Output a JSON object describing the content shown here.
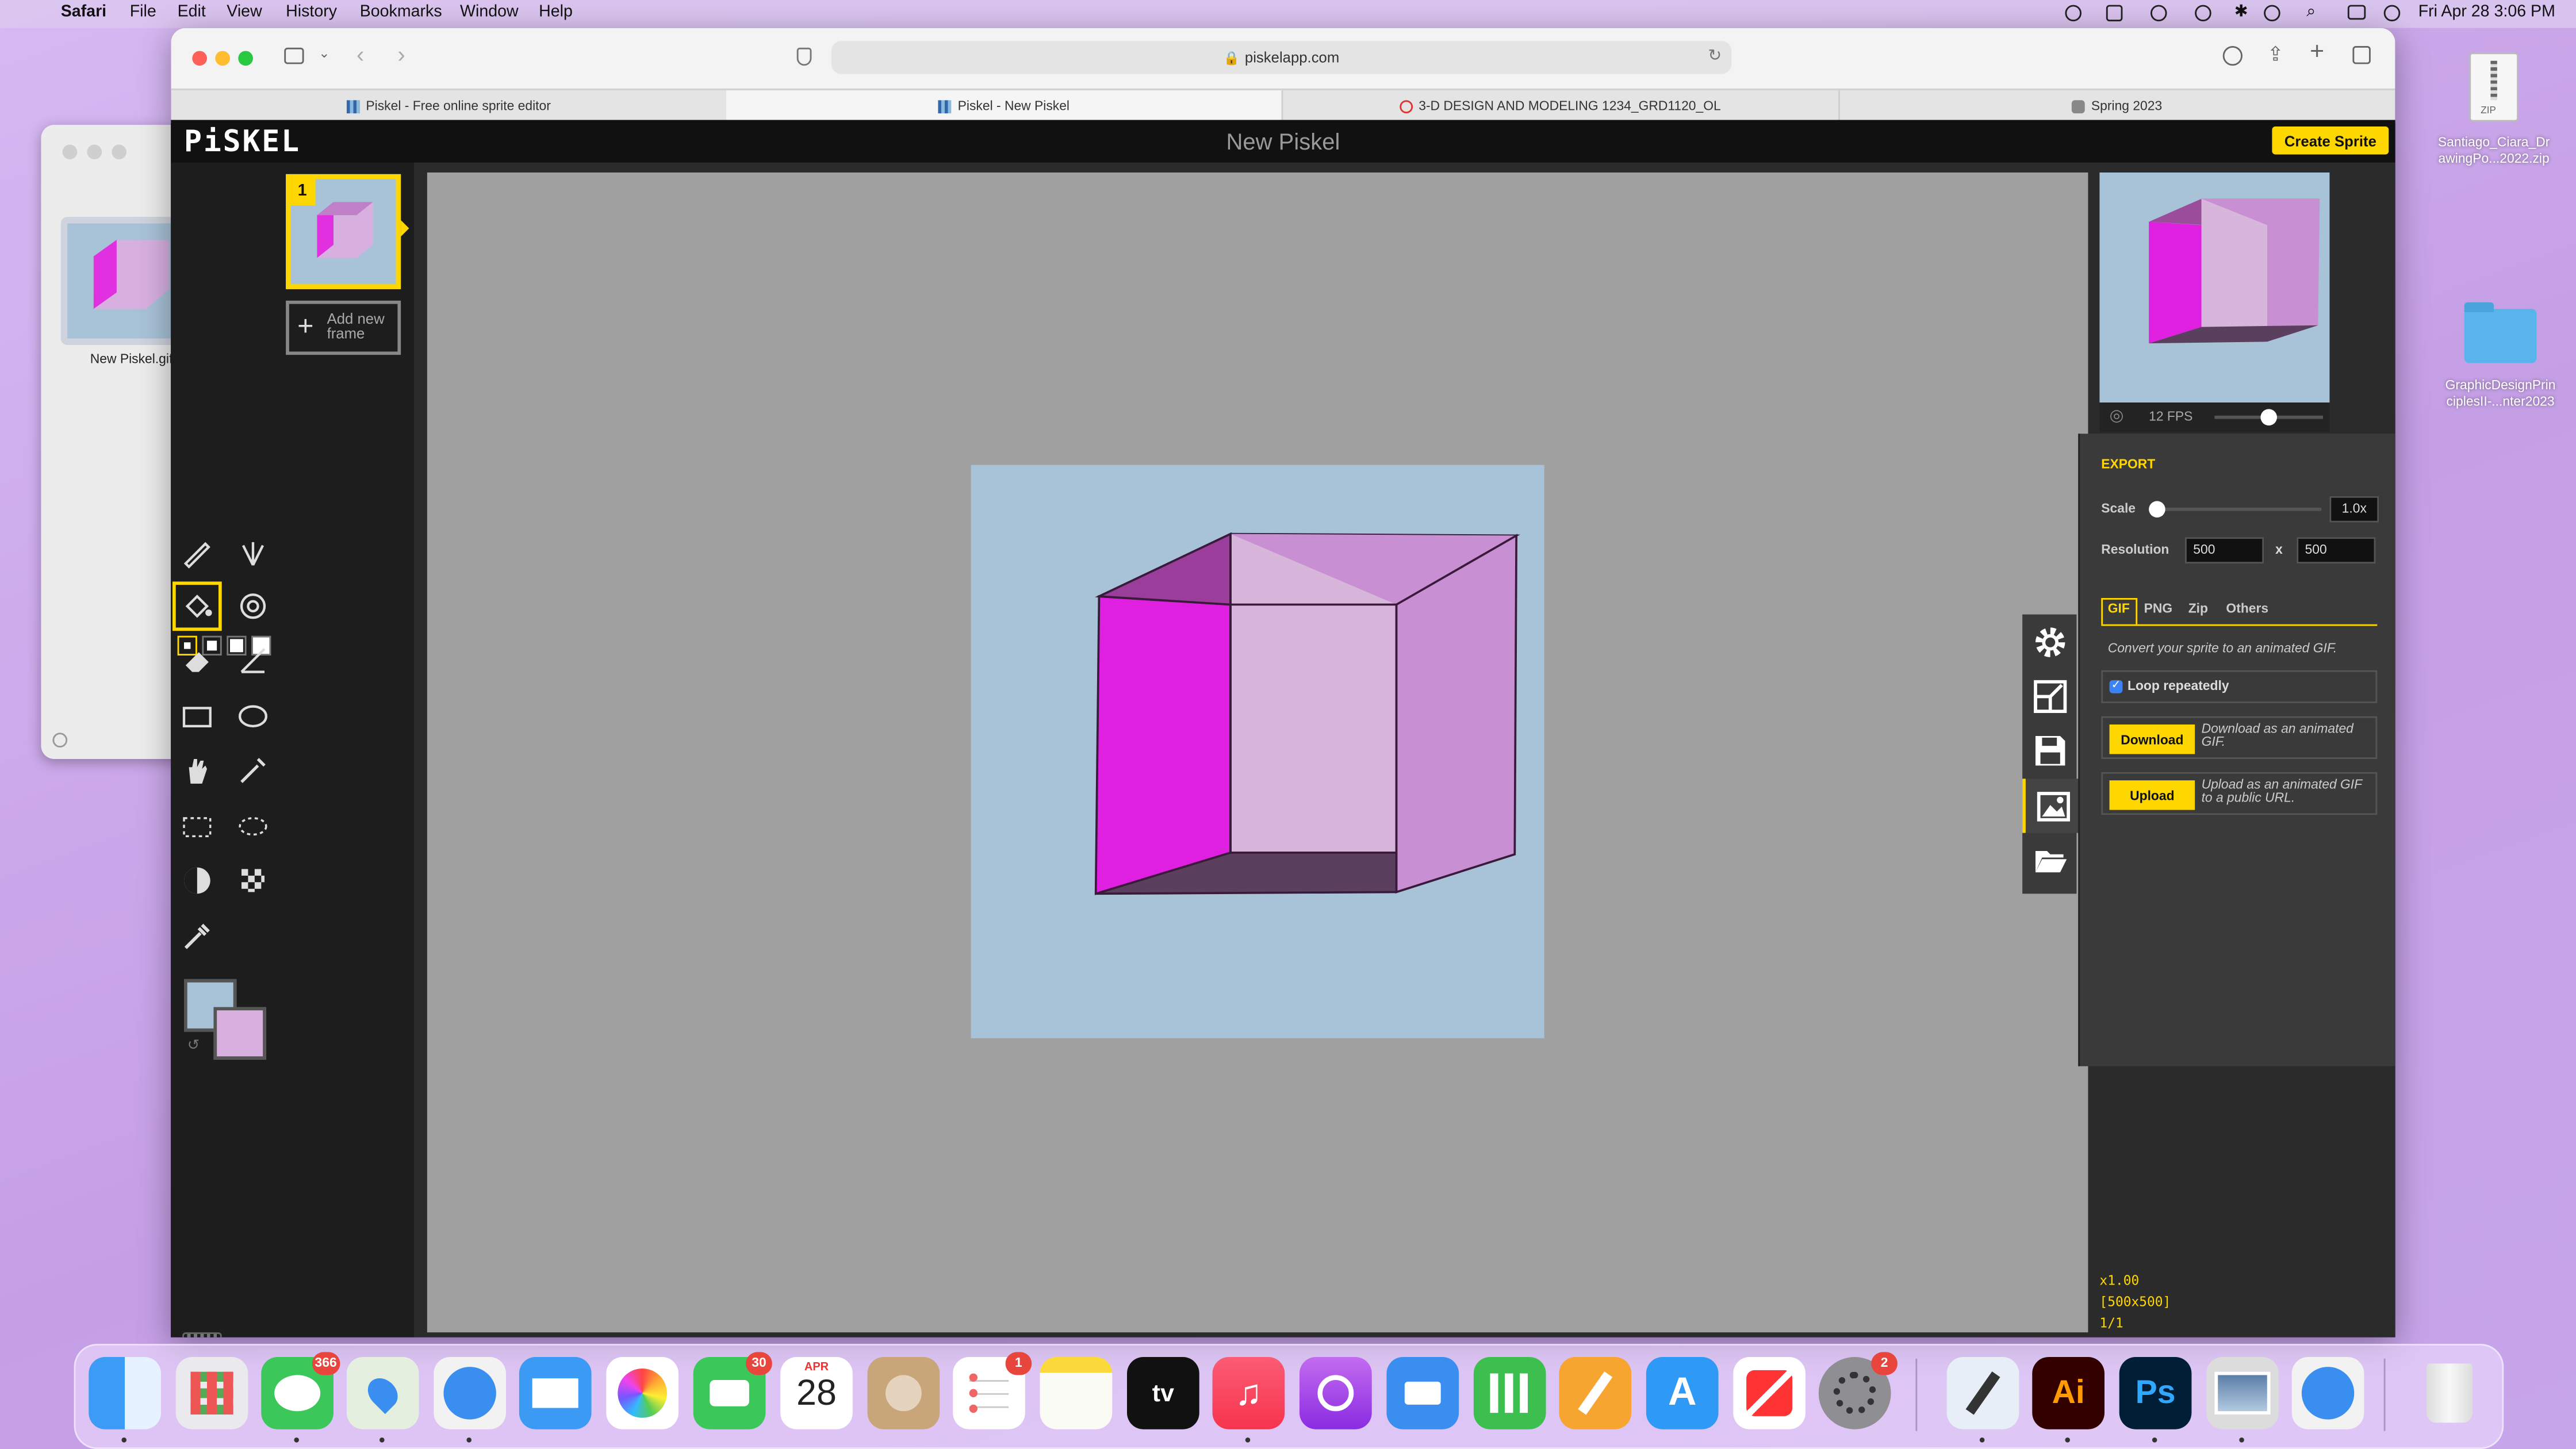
{
  "menubar": {
    "app_name": "Safari",
    "items": [
      "File",
      "Edit",
      "View",
      "History",
      "Bookmarks",
      "Window",
      "Help"
    ],
    "datetime": "Fri Apr 28  3:06 PM"
  },
  "finder": {
    "file_label": "New Piskel.gif"
  },
  "safari": {
    "url": "piskelapp.com",
    "tabs": [
      {
        "label": "Piskel - Free online sprite editor"
      },
      {
        "label": "Piskel - New Piskel"
      },
      {
        "label": "3-D DESIGN AND MODELING 1234_GRD1120_OL"
      },
      {
        "label": "Spring 2023"
      }
    ]
  },
  "piskel": {
    "logo": "PiSKEL",
    "title": "New Piskel",
    "create_sprite": "Create Sprite",
    "frame_number": "1",
    "add_frame_line1": "Add new",
    "add_frame_line2": "frame",
    "fps_label": "12 FPS",
    "fps_value": 12,
    "colors": {
      "primary": "#a8c2d8",
      "secondary": "#d8b0e0",
      "accent": "#ffd700"
    },
    "zoom": "x1.00",
    "size": "[500x500]",
    "frame_count": "1/1",
    "tools": [
      "pen-tool",
      "vertical-mirror-pen-tool",
      "paint-bucket-tool",
      "paint-same-color-tool",
      "eraser-tool",
      "stroke-tool",
      "rectangle-tool",
      "circle-tool",
      "move-tool",
      "shape-selection-tool",
      "rectangle-selection-tool",
      "lasso-selection-tool",
      "lighten-tool",
      "dithering-tool",
      "color-picker-tool"
    ]
  },
  "export": {
    "heading": "EXPORT",
    "scale_label": "Scale",
    "scale_value": "1.0x",
    "resolution_label": "Resolution",
    "width": "500",
    "x_label": "x",
    "height": "500",
    "tabs": [
      "GIF",
      "PNG",
      "Zip",
      "Others"
    ],
    "description": "Convert your sprite to an animated GIF.",
    "loop_label": "Loop repeatedly",
    "loop_checked": true,
    "download_label": "Download",
    "download_desc": "Download as an animated GIF.",
    "upload_label": "Upload",
    "upload_desc": "Upload as an animated GIF to a public URL."
  },
  "desktop": {
    "zip_label_line1": "Santiago_Ciara_Dr",
    "zip_label_line2": "awingPo...2022.zip",
    "zip_icon_text": "ZIP",
    "folder_label_line1": "GraphicDesignPrin",
    "folder_label_line2": "ciplesII-...nter2023"
  },
  "dock": {
    "messages_badge": "366",
    "facetime_badge": "30",
    "calendar_month": "APR",
    "calendar_day": "28",
    "reminders_badge": "1",
    "settings_badge": "2",
    "tv_label": "tv",
    "illustrator_label": "Ai",
    "photoshop_label": "Ps"
  }
}
